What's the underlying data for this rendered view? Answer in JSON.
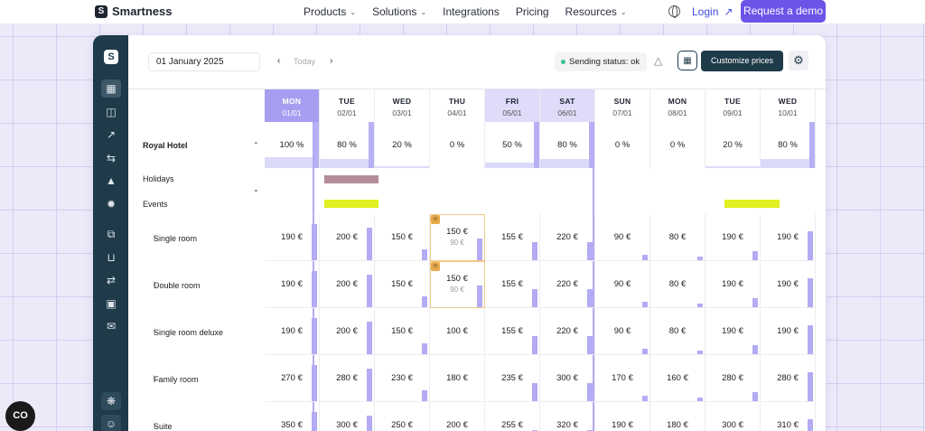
{
  "site": {
    "brand": "Smartness",
    "nav": [
      {
        "label": "Products",
        "chevron": true
      },
      {
        "label": "Solutions",
        "chevron": true
      },
      {
        "label": "Integrations",
        "chevron": false
      },
      {
        "label": "Pricing",
        "chevron": false
      },
      {
        "label": "Resources",
        "chevron": true
      }
    ],
    "login": "Login",
    "demo": "Request a demo"
  },
  "toolbar": {
    "date": "01 January 2025",
    "today": "Today",
    "sending": "Sending status: ok",
    "customize": "Customize prices"
  },
  "days": [
    {
      "name": "MON",
      "date": "01/01",
      "style": "sel"
    },
    {
      "name": "TUE",
      "date": "02/01",
      "style": ""
    },
    {
      "name": "WED",
      "date": "03/01",
      "style": ""
    },
    {
      "name": "THU",
      "date": "04/01",
      "style": ""
    },
    {
      "name": "FRI",
      "date": "05/01",
      "style": "wknd"
    },
    {
      "name": "SAT",
      "date": "06/01",
      "style": "wknd"
    },
    {
      "name": "SUN",
      "date": "07/01",
      "style": ""
    },
    {
      "name": "MON",
      "date": "08/01",
      "style": ""
    },
    {
      "name": "TUE",
      "date": "09/01",
      "style": ""
    },
    {
      "name": "WED",
      "date": "10/01",
      "style": ""
    }
  ],
  "hotel": {
    "name": "Royal Hotel",
    "occupancy": [
      "100 %",
      "80 %",
      "20 %",
      "0 %",
      "50 %",
      "80 %",
      "0 %",
      "0 %",
      "20 %",
      "80 %"
    ],
    "occupancy_level": [
      1.0,
      0.8,
      0.2,
      0.0,
      0.5,
      0.8,
      0.0,
      0.0,
      0.2,
      0.8
    ]
  },
  "labels": {
    "holidays": "Holidays",
    "events": "Events"
  },
  "rooms": [
    {
      "name": "Single room",
      "prices": [
        "190 €",
        "200 €",
        "150 €",
        "150 €",
        "155 €",
        "220 €",
        "90 €",
        "80 €",
        "190 €",
        "190 €"
      ],
      "orig": {
        "3": "90 €"
      },
      "bars": [
        1,
        0.9,
        0.3,
        0.6,
        0.5,
        0.5,
        0.15,
        0.1,
        0.25,
        0.8
      ]
    },
    {
      "name": "Double room",
      "prices": [
        "190 €",
        "200 €",
        "150 €",
        "150 €",
        "155 €",
        "220 €",
        "90 €",
        "80 €",
        "190 €",
        "190 €"
      ],
      "orig": {
        "3": "90 €"
      },
      "bars": [
        1,
        0.9,
        0.3,
        0.6,
        0.5,
        0.5,
        0.15,
        0.1,
        0.25,
        0.8
      ]
    },
    {
      "name": "Single room deluxe",
      "prices": [
        "190 €",
        "200 €",
        "150 €",
        "100 €",
        "155 €",
        "220 €",
        "90 €",
        "80 €",
        "190 €",
        "190 €"
      ],
      "orig": {},
      "bars": [
        1,
        0.9,
        0.3,
        0.0,
        0.5,
        0.5,
        0.15,
        0.1,
        0.25,
        0.8
      ]
    },
    {
      "name": "Family room",
      "prices": [
        "270 €",
        "280 €",
        "230 €",
        "180 €",
        "235 €",
        "300 €",
        "170 €",
        "160 €",
        "280 €",
        "280 €"
      ],
      "orig": {},
      "bars": [
        1,
        0.9,
        0.3,
        0.0,
        0.5,
        0.5,
        0.15,
        0.1,
        0.25,
        0.8
      ]
    },
    {
      "name": "Suite",
      "prices": [
        "350 €",
        "300 €",
        "250 €",
        "200 €",
        "255 €",
        "320 €",
        "190 €",
        "180 €",
        "300 €",
        "310 €"
      ],
      "orig": {},
      "bars": [
        1,
        0.9,
        0.3,
        0.0,
        0.5,
        0.5,
        0.15,
        0.1,
        0.25,
        0.8
      ]
    }
  ]
}
